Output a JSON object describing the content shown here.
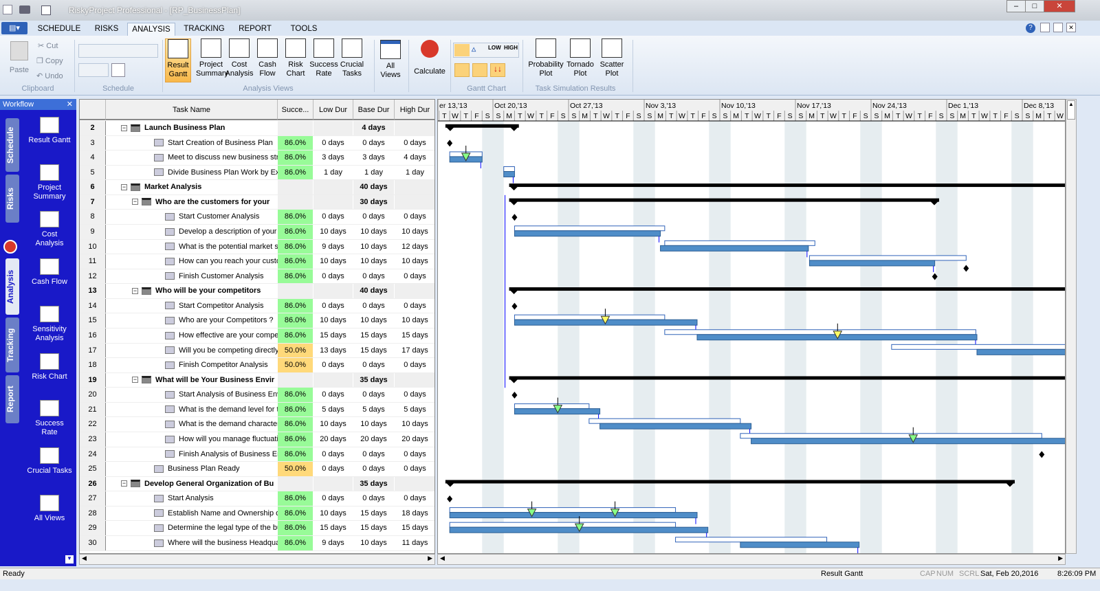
{
  "window": {
    "title": "RiskyProject Professional - [RP_BusinessPlan]"
  },
  "tabs": [
    "SCHEDULE",
    "RISKS",
    "ANALYSIS",
    "TRACKING",
    "REPORT",
    "TOOLS"
  ],
  "active_tab": "ANALYSIS",
  "ribbon": {
    "clipboard": {
      "paste": "Paste",
      "cut": "Cut",
      "copy": "Copy",
      "undo": "Undo",
      "group": "Clipboard"
    },
    "schedule_group": "Schedule",
    "analysis_views": [
      {
        "l1": "Result",
        "l2": "Gantt"
      },
      {
        "l1": "Project",
        "l2": "Summary"
      },
      {
        "l1": "Cost",
        "l2": "Analysis"
      },
      {
        "l1": "Cash",
        "l2": "Flow"
      },
      {
        "l1": "Risk",
        "l2": "Chart"
      },
      {
        "l1": "Success",
        "l2": "Rate"
      },
      {
        "l1": "Crucial",
        "l2": "Tasks"
      }
    ],
    "analysis_group": "Analysis Views",
    "all_views": {
      "l1": "All",
      "l2": "Views"
    },
    "calculate": "Calculate",
    "gantt_group": "Gantt Chart",
    "gantt_buttons": [
      "LOW",
      "HIGH"
    ],
    "sim": [
      {
        "l1": "Probability",
        "l2": "Plot"
      },
      {
        "l1": "Tornado",
        "l2": "Plot"
      },
      {
        "l1": "Scatter",
        "l2": "Plot"
      }
    ],
    "sim_group": "Task Simulation Results"
  },
  "workflow": {
    "title": "Workflow",
    "vtabs": [
      "Schedule",
      "Risks",
      "Analysis",
      "Tracking",
      "Report"
    ],
    "items": [
      {
        "l1": "Result Gantt",
        "l2": ""
      },
      {
        "l1": "Project",
        "l2": "Summary"
      },
      {
        "l1": "Cost",
        "l2": "Analysis"
      },
      {
        "l1": "Cash Flow",
        "l2": ""
      },
      {
        "l1": "Sensitivity",
        "l2": "Analysis"
      },
      {
        "l1": "Risk Chart",
        "l2": ""
      },
      {
        "l1": "Success",
        "l2": "Rate"
      },
      {
        "l1": "Crucial Tasks",
        "l2": ""
      },
      {
        "l1": "All Views",
        "l2": ""
      }
    ]
  },
  "table": {
    "headers": [
      "",
      "Task Name",
      "Succe...",
      "Low Dur",
      "Base Dur",
      "High Dur"
    ],
    "rows": [
      {
        "n": "2",
        "name": "Launch Business Plan",
        "lvl": 0,
        "sum": true,
        "s": "",
        "lo": "",
        "ba": "4 days",
        "hi": ""
      },
      {
        "n": "3",
        "name": "Start Creation of Business Plan",
        "lvl": 1,
        "s": "86.0%",
        "lo": "0 days",
        "ba": "0 days",
        "hi": "0 days"
      },
      {
        "n": "4",
        "name": "Meet to discuss new business strate",
        "lvl": 1,
        "s": "86.0%",
        "lo": "3 days",
        "ba": "3 days",
        "hi": "4 days"
      },
      {
        "n": "5",
        "name": "Divide Business Plan Work by Experi",
        "lvl": 1,
        "s": "86.0%",
        "lo": "1 day",
        "ba": "1 day",
        "hi": "1 day"
      },
      {
        "n": "6",
        "name": "Market Analysis",
        "lvl": 0,
        "sum": true,
        "s": "",
        "lo": "",
        "ba": "40 days",
        "hi": ""
      },
      {
        "n": "7",
        "name": "Who are the customers for your",
        "lvl": 1,
        "sum": true,
        "s": "",
        "lo": "",
        "ba": "30 days",
        "hi": ""
      },
      {
        "n": "8",
        "name": "Start Customer Analysis",
        "lvl": 2,
        "s": "86.0%",
        "lo": "0 days",
        "ba": "0 days",
        "hi": "0 days"
      },
      {
        "n": "9",
        "name": "Develop a description of your \"Ty",
        "lvl": 2,
        "s": "86.0%",
        "lo": "10 days",
        "ba": "10 days",
        "hi": "10 days"
      },
      {
        "n": "10",
        "name": "What is the potential market share",
        "lvl": 2,
        "s": "86.0%",
        "lo": "9 days",
        "ba": "10 days",
        "hi": "12 days"
      },
      {
        "n": "11",
        "name": "How can you reach your custome",
        "lvl": 2,
        "s": "86.0%",
        "lo": "10 days",
        "ba": "10 days",
        "hi": "10 days"
      },
      {
        "n": "12",
        "name": "Finish Customer Analysis",
        "lvl": 2,
        "s": "86.0%",
        "lo": "0 days",
        "ba": "0 days",
        "hi": "0 days"
      },
      {
        "n": "13",
        "name": "Who will be your competitors",
        "lvl": 1,
        "sum": true,
        "s": "",
        "lo": "",
        "ba": "40 days",
        "hi": ""
      },
      {
        "n": "14",
        "name": "Start Competitor Analysis",
        "lvl": 2,
        "s": "86.0%",
        "lo": "0 days",
        "ba": "0 days",
        "hi": "0 days"
      },
      {
        "n": "15",
        "name": "Who are your Competitors ?",
        "lvl": 2,
        "s": "86.0%",
        "lo": "10 days",
        "ba": "10 days",
        "hi": "10 days"
      },
      {
        "n": "16",
        "name": "How effective are your competito",
        "lvl": 2,
        "s": "86.0%",
        "lo": "15 days",
        "ba": "15 days",
        "hi": "15 days"
      },
      {
        "n": "17",
        "name": "Will you be competing directly wit",
        "lvl": 2,
        "s": "50.0%",
        "lo": "13 days",
        "ba": "15 days",
        "hi": "17 days"
      },
      {
        "n": "18",
        "name": "Finish Competitor Analysis",
        "lvl": 2,
        "s": "50.0%",
        "lo": "0 days",
        "ba": "0 days",
        "hi": "0 days"
      },
      {
        "n": "19",
        "name": "What will be Your Business Envir",
        "lvl": 1,
        "sum": true,
        "s": "",
        "lo": "",
        "ba": "35 days",
        "hi": ""
      },
      {
        "n": "20",
        "name": "Start Analysis of Business Enviro",
        "lvl": 2,
        "s": "86.0%",
        "lo": "0 days",
        "ba": "0 days",
        "hi": "0 days"
      },
      {
        "n": "21",
        "name": "What is the demand level for the p",
        "lvl": 2,
        "s": "86.0%",
        "lo": "5 days",
        "ba": "5 days",
        "hi": "5 days"
      },
      {
        "n": "22",
        "name": "What is the demand characteristic",
        "lvl": 2,
        "s": "86.0%",
        "lo": "10 days",
        "ba": "10 days",
        "hi": "10 days"
      },
      {
        "n": "23",
        "name": "How will you manage fluctuations",
        "lvl": 2,
        "s": "86.0%",
        "lo": "20 days",
        "ba": "20 days",
        "hi": "20 days"
      },
      {
        "n": "24",
        "name": "Finish Analysis of Business Envir",
        "lvl": 2,
        "s": "86.0%",
        "lo": "0 days",
        "ba": "0 days",
        "hi": "0 days"
      },
      {
        "n": "25",
        "name": "Business Plan Ready",
        "lvl": 1,
        "s": "50.0%",
        "lo": "0 days",
        "ba": "0 days",
        "hi": "0 days"
      },
      {
        "n": "26",
        "name": "Develop General Organization of Bu",
        "lvl": 0,
        "sum": true,
        "s": "",
        "lo": "",
        "ba": "35 days",
        "hi": ""
      },
      {
        "n": "27",
        "name": "Start Analysis",
        "lvl": 1,
        "s": "86.0%",
        "lo": "0 days",
        "ba": "0 days",
        "hi": "0 days"
      },
      {
        "n": "28",
        "name": "Establish Name and Ownership of Bu",
        "lvl": 1,
        "s": "86.0%",
        "lo": "10 days",
        "ba": "15 days",
        "hi": "18 days"
      },
      {
        "n": "29",
        "name": "Determine the legal type of the busine",
        "lvl": 1,
        "s": "86.0%",
        "lo": "15 days",
        "ba": "15 days",
        "hi": "15 days"
      },
      {
        "n": "30",
        "name": "Where will the business Headquarter",
        "lvl": 1,
        "s": "86.0%",
        "lo": "9 days",
        "ba": "10 days",
        "hi": "11 days"
      }
    ]
  },
  "colors": {
    "success_high": "#98fb98",
    "success_low": "#ffd97a",
    "bar": "#4f8dc8",
    "summary": "#000000",
    "weekend": "#e6edf0"
  },
  "gantt": {
    "weeks": [
      "er 13,'13",
      "Oct 20,'13",
      "Oct 27,'13",
      "Nov 3,'13",
      "Nov 10,'13",
      "Nov 17,'13",
      "Nov 24,'13",
      "Dec 1,'13",
      "Dec 8,'13"
    ],
    "day_letters": [
      "S",
      "M",
      "T",
      "W",
      "T",
      "F",
      "S"
    ],
    "first_day": 2,
    "last_day": 60,
    "items": [
      {
        "type": "sum",
        "a": 2.6,
        "b": 9.4
      },
      {
        "type": "ms",
        "a": 3
      },
      {
        "type": "bar",
        "a": 3,
        "b": 6,
        "oa": 3,
        "ob": 6,
        "tri": [
          4.5
        ],
        "tc": "#8f8"
      },
      {
        "type": "bar",
        "a": 8,
        "b": 9,
        "oa": 8,
        "ob": 9
      },
      {
        "type": "sum",
        "a": 8.5,
        "b": 62
      },
      {
        "type": "sum",
        "a": 8.5,
        "b": 48.3
      },
      {
        "type": "ms",
        "a": 9
      },
      {
        "type": "bar",
        "a": 9,
        "b": 22.5,
        "oa": 9,
        "ob": 22.9
      },
      {
        "type": "bar",
        "a": 22.5,
        "b": 36.2,
        "oa": 22.9,
        "ob": 36.8
      },
      {
        "type": "bar",
        "a": 36.3,
        "b": 47.9,
        "oa": 36.3,
        "ob": 50.8
      },
      {
        "type": "ms",
        "a": 47.9,
        "a2": 50.8
      },
      {
        "type": "sum",
        "a": 8.5,
        "b": 62
      },
      {
        "type": "ms",
        "a": 9
      },
      {
        "type": "bar",
        "a": 9,
        "b": 25.9,
        "oa": 9,
        "ob": 22.9,
        "tri": [
          17.4
        ],
        "tc": "#ff6"
      },
      {
        "type": "bar",
        "a": 25.9,
        "b": 51.8,
        "oa": 22.9,
        "ob": 51.7,
        "tri": [
          38.9
        ],
        "tc": "#ff6"
      },
      {
        "type": "bar",
        "a": 51.8,
        "b": 62,
        "oa": 43.9,
        "ob": 62
      },
      {
        "type": "none"
      },
      {
        "type": "sum",
        "a": 8.5,
        "b": 62
      },
      {
        "type": "ms",
        "a": 9
      },
      {
        "type": "bar",
        "a": 9,
        "b": 16.9,
        "oa": 9,
        "ob": 15.9,
        "tri": [
          13
        ],
        "tc": "#8f8"
      },
      {
        "type": "bar",
        "a": 16.9,
        "b": 30.9,
        "oa": 15.9,
        "ob": 29.9
      },
      {
        "type": "bar",
        "a": 30.9,
        "b": 62,
        "oa": 29.9,
        "ob": 57.8,
        "tri": [
          45.9
        ],
        "tc": "#8f8"
      },
      {
        "type": "ms",
        "a": 57.8
      },
      {
        "type": "none"
      },
      {
        "type": "sum",
        "a": 2.6,
        "b": 55.3
      },
      {
        "type": "ms",
        "a": 3
      },
      {
        "type": "bar",
        "a": 3,
        "b": 25.9,
        "oa": 3,
        "ob": 23.9,
        "tri": [
          10.6,
          18.3
        ],
        "tc": "#8f8"
      },
      {
        "type": "bar",
        "a": 3,
        "b": 26.9,
        "oa": 3,
        "ob": 23.9,
        "tri": [
          15
        ],
        "tc": "#8f8"
      },
      {
        "type": "bar",
        "a": 29.9,
        "b": 40.9,
        "oa": 23.9,
        "ob": 37.9
      }
    ]
  },
  "status": {
    "left": "Ready",
    "view": "Result Gantt",
    "cap": "CAP",
    "num": "NUM",
    "scrl": "SCRL",
    "date": "Sat, Feb 20,2016",
    "time": "8:26:09 PM"
  }
}
